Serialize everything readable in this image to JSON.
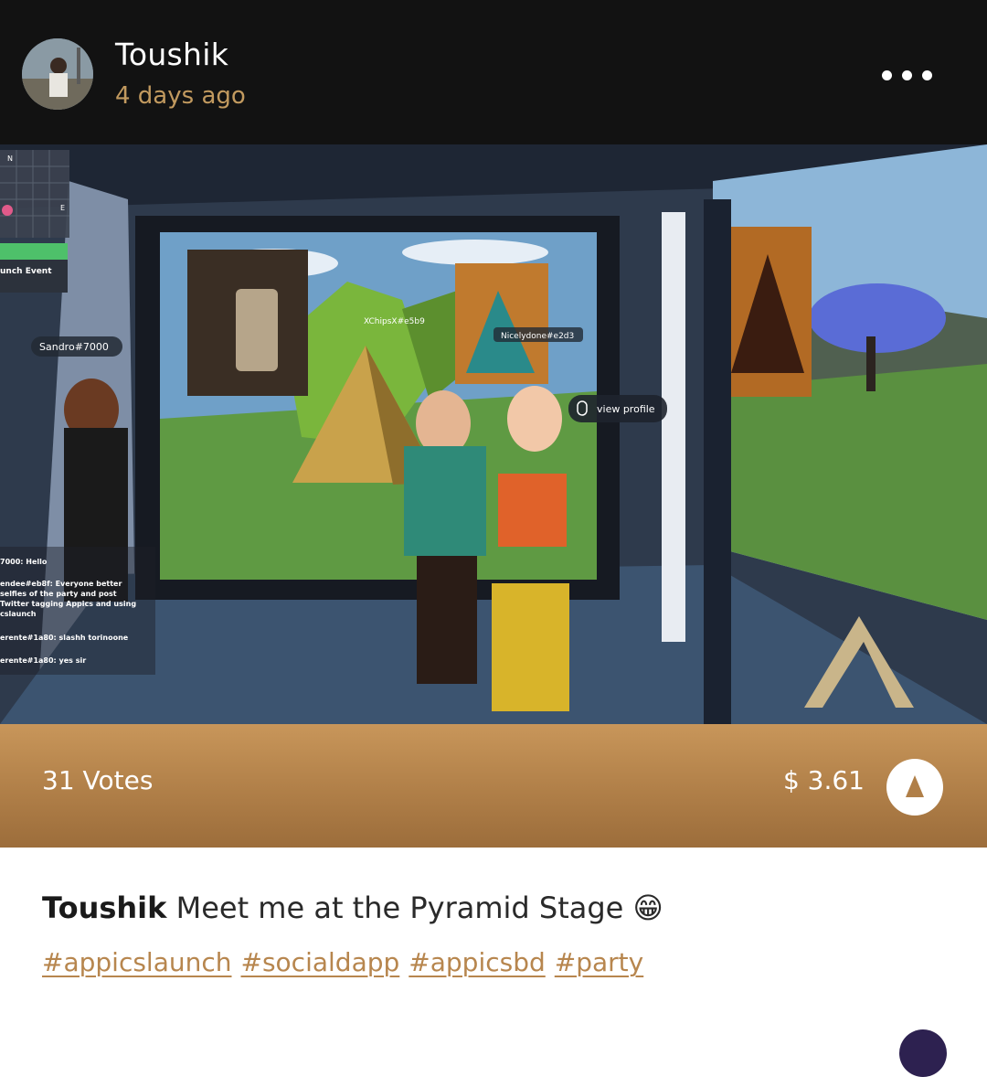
{
  "post": {
    "author": "Toushik",
    "time_ago": "4 days ago",
    "votes": "31 Votes",
    "payout": "$ 3.61",
    "caption_user": "Toushik",
    "caption_text": "Meet me at the Pyramid Stage 😁",
    "hashtags": [
      "#appicslaunch",
      "#socialdapp",
      "#appicsbd",
      "#party"
    ]
  },
  "scene": {
    "minimap_north": "N",
    "minimap_east": "E",
    "event_label": "unch Event",
    "player_tag_left": "Sandro#7000",
    "art_tag_1": "XChipsX#e5b9",
    "art_tag_2": "Nicelydone#e2d3",
    "view_profile": "view profile",
    "chat": [
      "7000: Hello",
      "endee#eb8f: Everyone better",
      "selfies of the party and post",
      "Twitter tagging Appics and using",
      "cslaunch",
      "erente#1a80: slashh torinoone",
      "erente#1a80: yes sir"
    ]
  },
  "icons": {
    "more": "more-horizontal-icon",
    "upvote": "upvote-arrow-icon"
  },
  "colors": {
    "header_bg": "#121212",
    "accent_gold": "#c29a5f",
    "hashtag": "#b7864e"
  }
}
